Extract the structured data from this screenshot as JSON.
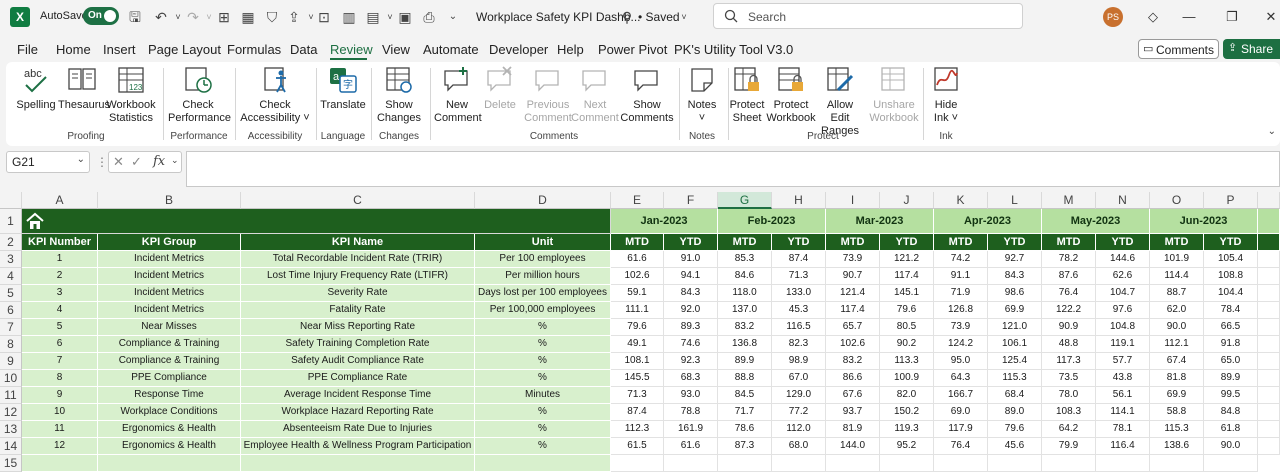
{
  "titlebar": {
    "autosave_label": "AutoSave",
    "autosave_state": "On",
    "doc_title": "Workplace Safety KPI Dashb...",
    "saved_status": "• Saved",
    "search_placeholder": "Search",
    "user_initials": "PS"
  },
  "tabs": [
    "File",
    "Home",
    "Insert",
    "Page Layout",
    "Formulas",
    "Data",
    "Review",
    "View",
    "Automate",
    "Developer",
    "Help",
    "Power Pivot",
    "PK's Utility Tool V3.0"
  ],
  "active_tab": "Review",
  "comments_button": "Comments",
  "share_button": "Share",
  "ribbon": {
    "spelling": "Spelling",
    "thesaurus": "Thesaurus",
    "workbook_statistics_1": "Workbook",
    "workbook_statistics_2": "Statistics",
    "check_performance_1": "Check",
    "check_performance_2": "Performance",
    "check_accessibility_1": "Check",
    "check_accessibility_2": "Accessibility ˅",
    "translate": "Translate",
    "show_changes_1": "Show",
    "show_changes_2": "Changes",
    "new_comment_1": "New",
    "new_comment_2": "Comment",
    "delete": "Delete",
    "previous_comment_1": "Previous",
    "previous_comment_2": "Comment",
    "next_comment_1": "Next",
    "next_comment_2": "Comment",
    "show_comments_1": "Show",
    "show_comments_2": "Comments",
    "notes_1": "Notes",
    "notes_2": "˅",
    "protect_sheet_1": "Protect",
    "protect_sheet_2": "Sheet",
    "protect_workbook_1": "Protect",
    "protect_workbook_2": "Workbook",
    "allow_edit_ranges_1": "Allow Edit",
    "allow_edit_ranges_2": "Ranges",
    "unshare_workbook_1": "Unshare",
    "unshare_workbook_2": "Workbook",
    "hide_ink_1": "Hide",
    "hide_ink_2": "Ink ˅",
    "groups": {
      "proofing": "Proofing",
      "performance": "Performance",
      "accessibility": "Accessibility",
      "language": "Language",
      "changes": "Changes",
      "comments": "Comments",
      "notes": "Notes",
      "protect": "Protect",
      "ink": "Ink"
    }
  },
  "formula_bar": {
    "name_box": "G21",
    "fx": "fx",
    "formula": ""
  },
  "grid": {
    "column_letters": [
      "A",
      "B",
      "C",
      "D",
      "E",
      "F",
      "G",
      "H",
      "I",
      "J",
      "K",
      "L",
      "M",
      "N",
      "O",
      "P"
    ],
    "selected_column": "G",
    "row_numbers": [
      "1",
      "2",
      "3",
      "4",
      "5",
      "6",
      "7",
      "8",
      "9",
      "10",
      "11",
      "12",
      "13",
      "14",
      "15"
    ],
    "headers": [
      "KPI Number",
      "KPI Group",
      "KPI Name",
      "Unit"
    ],
    "months": [
      "Jan-2023",
      "Feb-2023",
      "Mar-2023",
      "Apr-2023",
      "May-2023",
      "Jun-2023"
    ],
    "mtd_label": "MTD",
    "ytd_label": "YTD",
    "rows": [
      {
        "num": "1",
        "group": "Incident Metrics",
        "name": "Total Recordable Incident Rate (TRIR)",
        "unit": "Per 100 employees",
        "values": [
          "61.6",
          "91.0",
          "85.3",
          "87.4",
          "73.9",
          "121.2",
          "74.2",
          "92.7",
          "78.2",
          "144.6",
          "101.9",
          "105.4"
        ]
      },
      {
        "num": "2",
        "group": "Incident Metrics",
        "name": "Lost Time Injury Frequency Rate (LTIFR)",
        "unit": "Per million hours",
        "values": [
          "102.6",
          "94.1",
          "84.6",
          "71.3",
          "90.7",
          "117.4",
          "91.1",
          "84.3",
          "87.6",
          "62.6",
          "114.4",
          "108.8"
        ]
      },
      {
        "num": "3",
        "group": "Incident Metrics",
        "name": "Severity Rate",
        "unit": "Days lost per 100 employees",
        "values": [
          "59.1",
          "84.3",
          "118.0",
          "133.0",
          "121.4",
          "145.1",
          "71.9",
          "98.6",
          "76.4",
          "104.7",
          "88.7",
          "104.4"
        ]
      },
      {
        "num": "4",
        "group": "Incident Metrics",
        "name": "Fatality Rate",
        "unit": "Per 100,000 employees",
        "values": [
          "111.1",
          "92.0",
          "137.0",
          "45.3",
          "117.4",
          "79.6",
          "126.8",
          "69.9",
          "122.2",
          "97.6",
          "62.0",
          "78.4"
        ]
      },
      {
        "num": "5",
        "group": "Near Misses",
        "name": "Near Miss Reporting Rate",
        "unit": "%",
        "values": [
          "79.6",
          "89.3",
          "83.2",
          "116.5",
          "65.7",
          "80.5",
          "73.9",
          "121.0",
          "90.9",
          "104.8",
          "90.0",
          "66.5"
        ]
      },
      {
        "num": "6",
        "group": "Compliance & Training",
        "name": "Safety Training Completion Rate",
        "unit": "%",
        "values": [
          "49.1",
          "74.6",
          "136.8",
          "82.3",
          "102.6",
          "90.2",
          "124.2",
          "106.1",
          "48.8",
          "119.1",
          "112.1",
          "91.8"
        ]
      },
      {
        "num": "7",
        "group": "Compliance & Training",
        "name": "Safety Audit Compliance Rate",
        "unit": "%",
        "values": [
          "108.1",
          "92.3",
          "89.9",
          "98.9",
          "83.2",
          "113.3",
          "95.0",
          "125.4",
          "117.3",
          "57.7",
          "67.4",
          "65.0"
        ]
      },
      {
        "num": "8",
        "group": "PPE Compliance",
        "name": "PPE Compliance Rate",
        "unit": "%",
        "values": [
          "145.5",
          "68.3",
          "88.8",
          "67.0",
          "86.6",
          "100.9",
          "64.3",
          "115.3",
          "73.5",
          "43.8",
          "81.8",
          "89.9"
        ]
      },
      {
        "num": "9",
        "group": "Response Time",
        "name": "Average Incident Response Time",
        "unit": "Minutes",
        "values": [
          "71.3",
          "93.0",
          "84.5",
          "129.0",
          "67.6",
          "82.0",
          "166.7",
          "68.4",
          "78.0",
          "56.1",
          "69.9",
          "99.5"
        ]
      },
      {
        "num": "10",
        "group": "Workplace Conditions",
        "name": "Workplace Hazard Reporting Rate",
        "unit": "%",
        "values": [
          "87.4",
          "78.8",
          "71.7",
          "77.2",
          "93.7",
          "150.2",
          "69.0",
          "89.0",
          "108.3",
          "114.1",
          "58.8",
          "84.8"
        ]
      },
      {
        "num": "11",
        "group": "Ergonomics & Health",
        "name": "Absenteeism Rate Due to Injuries",
        "unit": "%",
        "values": [
          "112.3",
          "161.9",
          "78.6",
          "112.0",
          "81.9",
          "119.3",
          "117.9",
          "79.6",
          "64.2",
          "78.1",
          "115.3",
          "61.8"
        ]
      },
      {
        "num": "12",
        "group": "Ergonomics & Health",
        "name": "Employee Health & Wellness Program Participation",
        "unit": "%",
        "values": [
          "61.5",
          "61.6",
          "87.3",
          "68.0",
          "144.0",
          "95.2",
          "76.4",
          "45.6",
          "79.9",
          "116.4",
          "138.6",
          "90.0"
        ]
      }
    ]
  }
}
